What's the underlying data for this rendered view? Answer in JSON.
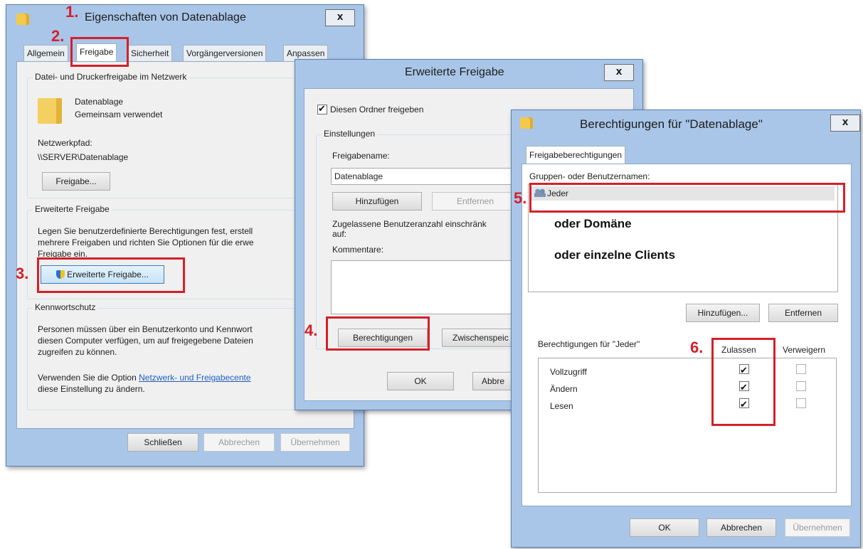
{
  "steps": [
    "1.",
    "2.",
    "3.",
    "4.",
    "5.",
    "6."
  ],
  "props": {
    "title": "Eigenschaften von Datenablage",
    "close": "x",
    "tabs": [
      "Allgemein",
      "Freigabe",
      "Sicherheit",
      "Vorgängerversionen",
      "Anpassen"
    ],
    "net_group": "Datei- und Druckerfreigabe im Netzwerk",
    "folder_name": "Datenablage",
    "folder_status": "Gemeinsam verwendet",
    "path_label": "Netzwerkpfad:",
    "path_value": "\\\\SERVER\\Datenablage",
    "share_button": "Freigabe...",
    "adv_group": "Erweiterte Freigabe",
    "adv_text": [
      "Legen Sie benutzerdefinierte Berechtigungen fest, erstell",
      "mehrere Freigaben und richten Sie Optionen für die erwe",
      "Freigabe ein."
    ],
    "adv_button": "Erweiterte Freigabe...",
    "pw_group": "Kennwortschutz",
    "pw_text": [
      "Personen müssen über ein Benutzerkonto und Kennwort",
      "diesen Computer verfügen, um auf freigegebene Dateien",
      "zugreifen zu können."
    ],
    "pw_text2_prefix": "Verwenden Sie die Option ",
    "pw_link": "Netzwerk- und Freigabecente",
    "pw_text2_line2": "diese Einstellung zu ändern.",
    "close_btn": "Schließen",
    "cancel_btn": "Abbrechen",
    "apply_btn": "Übernehmen"
  },
  "adv": {
    "title": "Erweiterte Freigabe",
    "close": "x",
    "share_check": "Diesen Ordner freigeben",
    "settings_group": "Einstellungen",
    "share_name_label": "Freigabename:",
    "share_name_value": "Datenablage",
    "add_btn": "Hinzufügen",
    "remove_btn": "Entfernen",
    "limit_label": [
      "Zugelassene Benutzeranzahl einschränk",
      "auf:"
    ],
    "comments_label": "Kommentare:",
    "perm_btn": "Berechtigungen",
    "cache_btn": "Zwischenspeic",
    "ok_btn": "OK",
    "cancel_btn": "Abbre"
  },
  "perm": {
    "title": "Berechtigungen für \"Datenablage\"",
    "close": "x",
    "tab": "Freigabeberechtigungen",
    "groups_label": "Gruppen- oder Benutzernamen:",
    "user": "Jeder",
    "note1": "oder Domäne",
    "note2": "oder einzelne Clients",
    "add_btn": "Hinzufügen...",
    "remove_btn": "Entfernen",
    "perms_for": "Berechtigungen für \"Jeder\"",
    "allow_col": "Zulassen",
    "deny_col": "Verweigern",
    "rows": [
      {
        "name": "Vollzugriff",
        "allow": true,
        "deny": false
      },
      {
        "name": "Ändern",
        "allow": true,
        "deny": false
      },
      {
        "name": "Lesen",
        "allow": true,
        "deny": false
      }
    ],
    "ok_btn": "OK",
    "cancel_btn": "Abbrechen",
    "apply_btn": "Übernehmen"
  }
}
